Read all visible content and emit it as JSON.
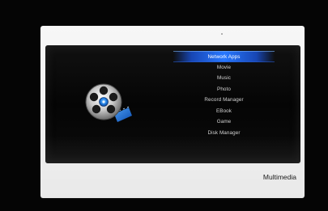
{
  "screen": {
    "title": "Multimedia",
    "accent_color": "#2e78ff",
    "icon": "film-reel-icon"
  },
  "menu": {
    "selected_index": 0,
    "items": [
      {
        "label": "Network Apps"
      },
      {
        "label": "Movie"
      },
      {
        "label": "Music"
      },
      {
        "label": "Photo"
      },
      {
        "label": "Record Manager"
      },
      {
        "label": "EBook"
      },
      {
        "label": "Game"
      },
      {
        "label": "Disk Manager"
      }
    ]
  }
}
